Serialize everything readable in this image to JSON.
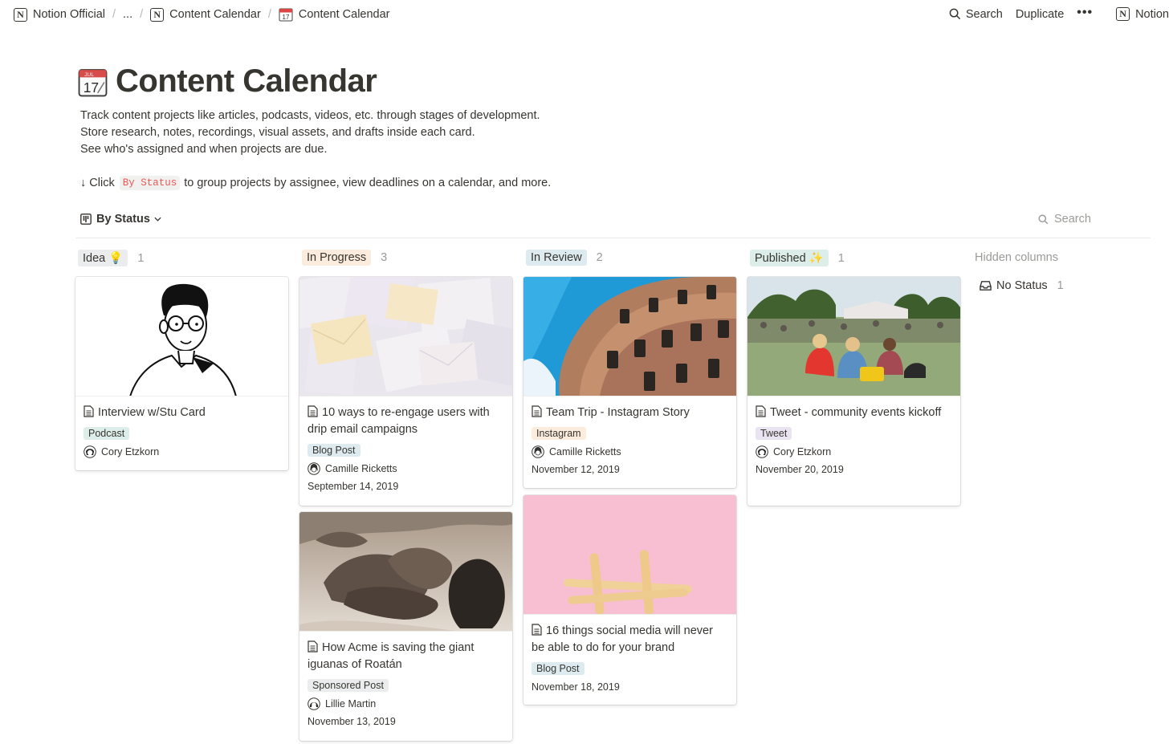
{
  "breadcrumb": {
    "items": [
      {
        "label": "Notion Official",
        "icon": "notion-logo-icon"
      },
      {
        "label": "..."
      },
      {
        "label": "Content Calendar",
        "icon": "notion-logo-icon"
      },
      {
        "label": "Content Calendar",
        "icon": "calendar-icon"
      }
    ],
    "separator": "/",
    "n_glyph": "N"
  },
  "topbar": {
    "search_label": "Search",
    "duplicate_label": "Duplicate",
    "more_label": "•••",
    "notion_label": "Notion"
  },
  "page": {
    "title": "Content Calendar",
    "icon": "calendar-icon",
    "calendar_icon_month": "JUL",
    "calendar_icon_day": "17",
    "description_lines": [
      "Track content projects like articles, podcasts, videos, etc. through stages of development.",
      "Store research, notes, recordings, visual assets, and drafts inside each card.",
      "See who's assigned and when projects are due."
    ],
    "hint_prefix": "↓ Click",
    "hint_code": "By Status",
    "hint_suffix": "to group projects by assignee, view deadlines on a calendar, and more."
  },
  "view": {
    "label": "By Status",
    "search_placeholder": "Search"
  },
  "colors": {
    "idea": "#ebeced",
    "in_progress": "#fbecdd",
    "in_review": "#ddebf1",
    "published": "#ddedea",
    "podcast": "#ddedea",
    "blog_post": "#ddebf1",
    "instagram": "#fbecdd",
    "tweet": "#eae4f2",
    "sponsored": "#ebeced"
  },
  "columns": [
    {
      "label": "Idea",
      "emoji": "💡",
      "count": "1"
    },
    {
      "label": "In Progress",
      "emoji": "",
      "count": "3"
    },
    {
      "label": "In Review",
      "emoji": "",
      "count": "2"
    },
    {
      "label": "Published",
      "emoji": "✨",
      "count": "1"
    }
  ],
  "hidden": {
    "heading": "Hidden columns",
    "items": [
      {
        "label": "No Status",
        "count": "1",
        "icon": "inbox-icon"
      }
    ]
  },
  "cards": [
    {
      "title": "Interview w/Stu Card",
      "tag": "Podcast",
      "person": "Cory Etzkorn",
      "date": "",
      "image": "illustration-portrait"
    },
    {
      "title": "10 ways to re-engage users with drip email campaigns",
      "tag": "Blog Post",
      "person": "Camille Ricketts",
      "date": "September 14, 2019",
      "image": "envelopes-photo"
    },
    {
      "title": "How Acme is saving the giant iguanas of Roatán",
      "tag": "Sponsored Post",
      "person": "Lillie Martin",
      "date": "November 13, 2019",
      "image": "iguanas-photo"
    },
    {
      "title": "Team Trip - Instagram Story",
      "tag": "Instagram",
      "person": "Camille Ricketts",
      "date": "November 12, 2019",
      "image": "building-photo"
    },
    {
      "title": "16 things social media will never be able to do for your brand",
      "tag": "Blog Post",
      "person": "",
      "date": "November 18, 2019",
      "image": "hashtag-photo"
    },
    {
      "title": "Tweet - community events kickoff",
      "tag": "Tweet",
      "person": "Cory Etzkorn",
      "date": "November 20, 2019",
      "image": "festival-photo"
    }
  ]
}
